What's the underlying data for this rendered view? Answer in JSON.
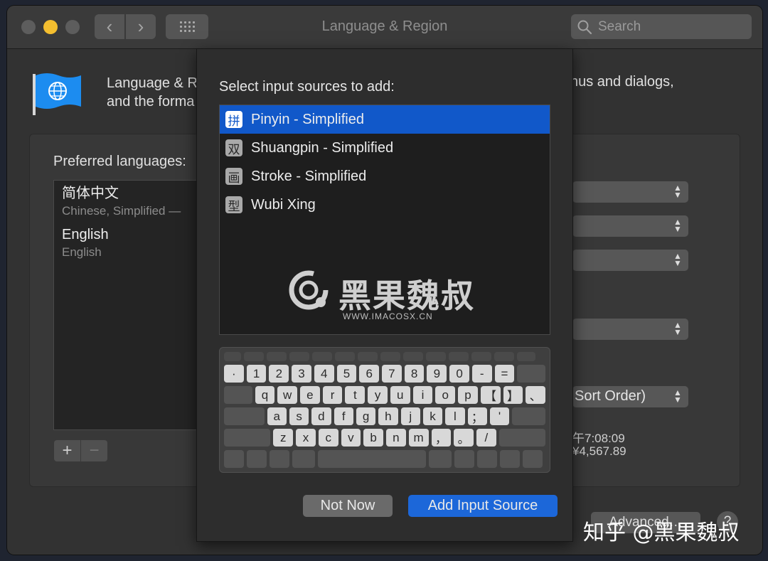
{
  "window": {
    "title": "Language & Region",
    "search_placeholder": "Search"
  },
  "header": {
    "text_line1": "Language & R",
    "text_line2": "and the forma",
    "text_right": "nus and dialogs,"
  },
  "languages": {
    "label": "Preferred languages:",
    "items": [
      {
        "primary": "简体中文",
        "secondary": "Chinese, Simplified —"
      },
      {
        "primary": "English",
        "secondary": "English"
      }
    ],
    "add_label": "+",
    "remove_label": "−"
  },
  "settings": {
    "sort_order_label": "Sort Order)",
    "time_sample": "午7:08:09",
    "number_sample": "¥4,567.89"
  },
  "sheet": {
    "title": "Select input sources to add:",
    "sources": [
      {
        "icon": "拼",
        "label": "Pinyin - Simplified",
        "selected": true
      },
      {
        "icon": "双",
        "label": "Shuangpin - Simplified",
        "selected": false
      },
      {
        "icon": "画",
        "label": "Stroke - Simplified",
        "selected": false
      },
      {
        "icon": "型",
        "label": "Wubi Xing",
        "selected": false
      }
    ],
    "watermark": {
      "text": "黑果魏叔",
      "url": "WWW.IMACOSX.CN"
    },
    "keyboard": {
      "row1": [
        "·",
        "1",
        "2",
        "3",
        "4",
        "5",
        "6",
        "7",
        "8",
        "9",
        "0",
        "-",
        "="
      ],
      "row2": [
        "q",
        "w",
        "e",
        "r",
        "t",
        "y",
        "u",
        "i",
        "o",
        "p",
        "【",
        "】",
        "、"
      ],
      "row3": [
        "a",
        "s",
        "d",
        "f",
        "g",
        "h",
        "j",
        "k",
        "l",
        "；",
        "'"
      ],
      "row4": [
        "z",
        "x",
        "c",
        "v",
        "b",
        "n",
        "m",
        "，",
        "。",
        "/"
      ]
    },
    "not_now": "Not Now",
    "add_input_source": "Add Input Source"
  },
  "footer": {
    "advanced": "Advanced…",
    "help": "?"
  },
  "overlay": {
    "zhihu": "知乎 @黑果魏叔"
  },
  "colors": {
    "accent": "#1158c9",
    "button_primary": "#1c67d9",
    "traffic_yellow": "#f4be2f"
  }
}
